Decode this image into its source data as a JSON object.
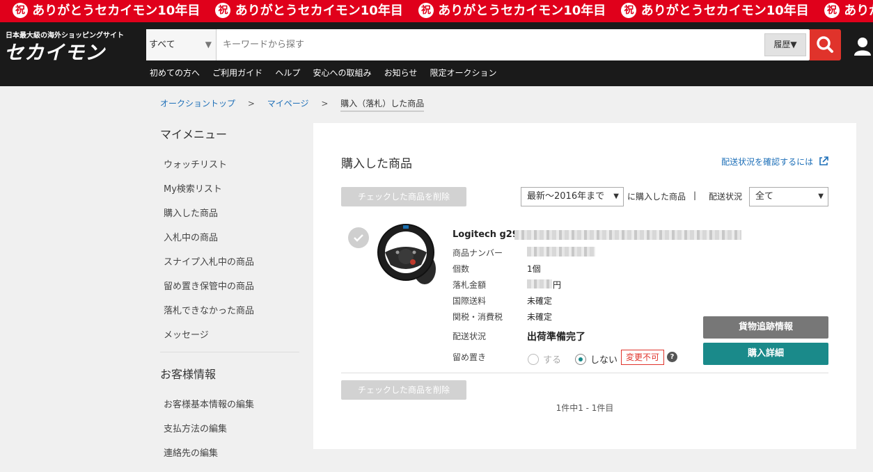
{
  "banner": {
    "message": "ありがとうセカイモン10年目",
    "badge": "祝"
  },
  "header": {
    "logo_tagline": "日本最大級の海外ショッピングサイト",
    "logo": "セカイモン",
    "search_category": "すべて",
    "search_placeholder": "キーワードから探す",
    "history_label": "履歴▼",
    "nav": [
      "初めての方へ",
      "ご利用ガイド",
      "ヘルプ",
      "安心への取組み",
      "お知らせ",
      "限定オークション"
    ]
  },
  "breadcrumb": {
    "items": [
      "オークショントップ",
      "マイページ",
      "購入（落札）した商品"
    ],
    "separator": ">"
  },
  "sidebar": {
    "menu_title": "マイメニュー",
    "menu_items": [
      "ウォッチリスト",
      "My検索リスト",
      "購入した商品",
      "入札中の商品",
      "スナイプ入札中の商品",
      "留め置き保管中の商品",
      "落札できなかった商品",
      "メッセージ"
    ],
    "customer_title": "お客様情報",
    "customer_items": [
      "お客様基本情報の編集",
      "支払方法の編集",
      "連絡先の編集"
    ]
  },
  "main": {
    "title": "購入した商品",
    "shipping_check_link": "配送状況を確認するには",
    "delete_checked_label": "チェックした商品を削除",
    "period_select": "最新～2016年まで",
    "period_suffix": "に購入した商品",
    "divider": "|",
    "shipping_status_label": "配送状況",
    "shipping_status_select": "全て",
    "pagination": "1件中1 - 1件目"
  },
  "product": {
    "name": "Logitech g29",
    "fields": {
      "item_number_label": "商品ナンバー",
      "quantity_label": "個数",
      "quantity": "1個",
      "winning_price_label": "落札金額",
      "winning_price_unit": "円",
      "intl_shipping_label": "国際送料",
      "intl_shipping": "未確定",
      "customs_label": "関税・消費税",
      "customs": "未確定",
      "delivery_label": "配送状況",
      "delivery": "出荷準備完了",
      "hold_label": "留め置き",
      "hold_yes": "する",
      "hold_no": "しない",
      "hold_selected": "しない",
      "change_badge": "変更不可",
      "help": "?"
    },
    "tracking_button": "貨物追跡情報",
    "detail_button": "購入詳細"
  },
  "colors": {
    "brand_red": "#e0001b",
    "header_bg": "#1a1a1a",
    "teal": "#1a8a8a",
    "link_blue": "#1d6fb8"
  }
}
